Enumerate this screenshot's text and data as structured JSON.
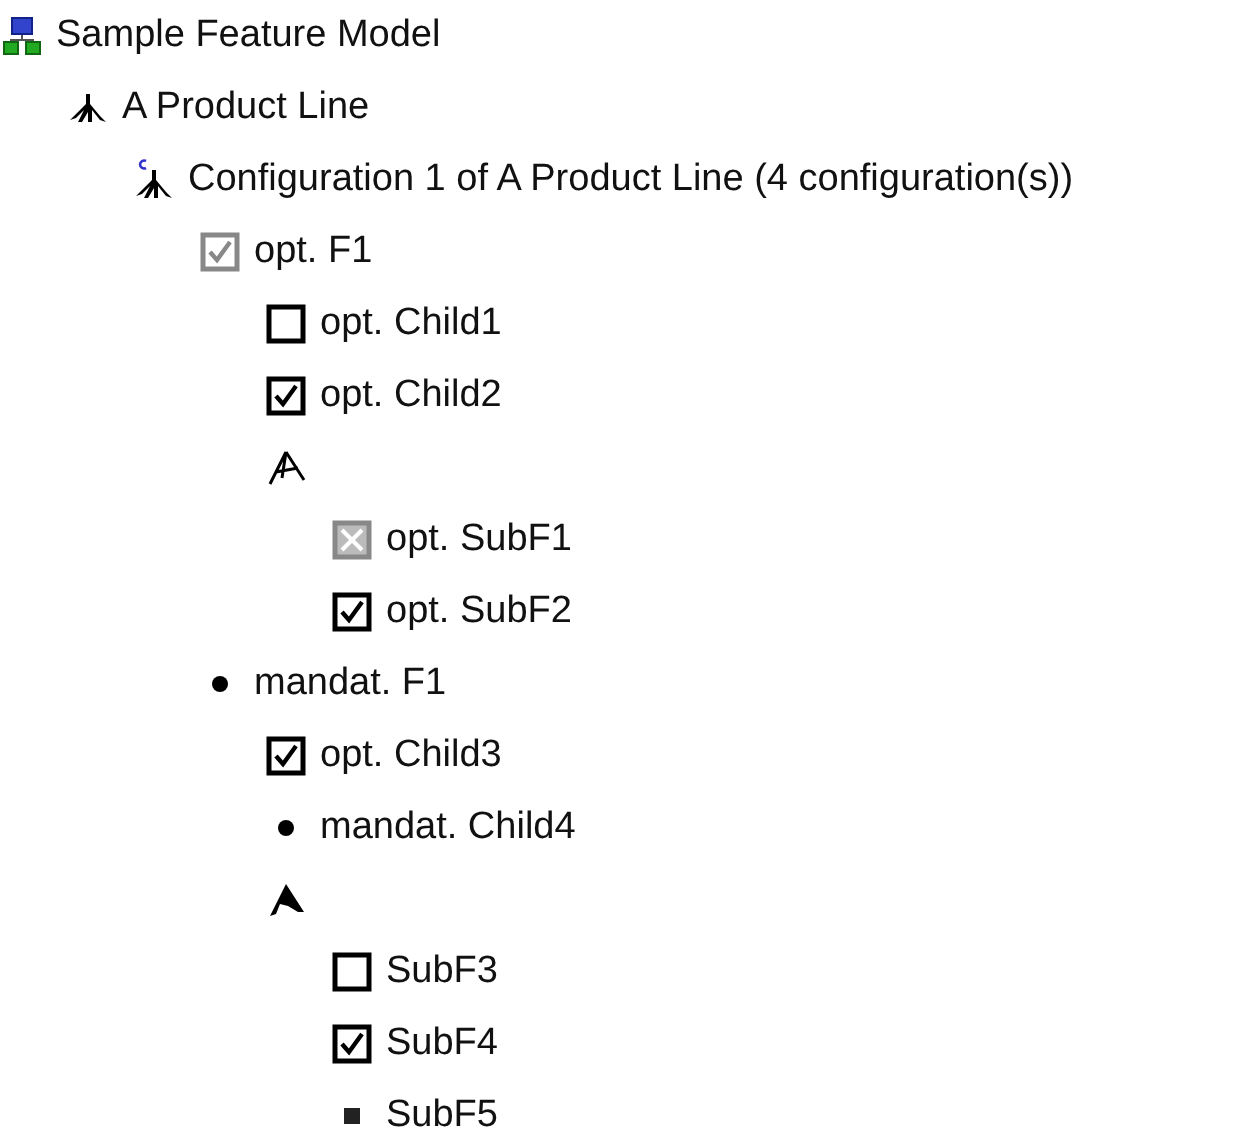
{
  "tree": [
    {
      "kind": "model",
      "label": "Sample Feature Model",
      "children": [
        {
          "kind": "product-line",
          "label": "A Product Line",
          "children": [
            {
              "kind": "configuration",
              "label": "Configuration 1 of A Product Line (4 configuration(s))",
              "children": [
                {
                  "kind": "optional",
                  "label": "opt. F1",
                  "checked": true,
                  "disabled": true,
                  "excluded": false,
                  "children": [
                    {
                      "kind": "optional",
                      "label": "opt. Child1",
                      "checked": false,
                      "disabled": false,
                      "excluded": false
                    },
                    {
                      "kind": "optional",
                      "label": "opt. Child2",
                      "checked": true,
                      "disabled": false,
                      "excluded": false
                    },
                    {
                      "kind": "or-group",
                      "children": [
                        {
                          "kind": "optional",
                          "label": "opt. SubF1",
                          "checked": false,
                          "disabled": true,
                          "excluded": true
                        },
                        {
                          "kind": "optional",
                          "label": "opt. SubF2",
                          "checked": true,
                          "disabled": false,
                          "excluded": false
                        }
                      ]
                    }
                  ]
                },
                {
                  "kind": "mandatory",
                  "label": "mandat. F1",
                  "children": [
                    {
                      "kind": "optional",
                      "label": "opt. Child3",
                      "checked": true,
                      "disabled": false,
                      "excluded": false
                    },
                    {
                      "kind": "mandatory",
                      "label": "mandat. Child4"
                    },
                    {
                      "kind": "alternative-group",
                      "children": [
                        {
                          "kind": "optional",
                          "label": "SubF3",
                          "checked": false,
                          "disabled": false,
                          "excluded": false
                        },
                        {
                          "kind": "optional",
                          "label": "SubF4",
                          "checked": true,
                          "disabled": false,
                          "excluded": false
                        },
                        {
                          "kind": "selected-alternative",
                          "label": "SubF5"
                        }
                      ]
                    }
                  ]
                }
              ]
            }
          ]
        }
      ]
    }
  ]
}
